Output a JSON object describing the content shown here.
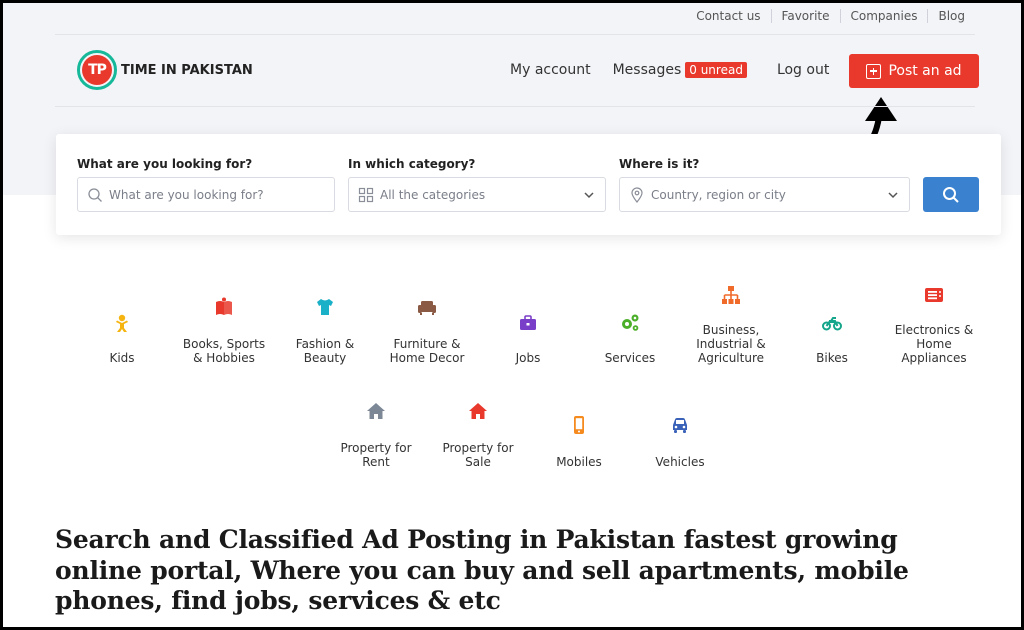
{
  "topbar": {
    "links": [
      "Contact us",
      "Favorite",
      "Companies",
      "Blog"
    ]
  },
  "logo": {
    "mark": "TP",
    "text": "TIME IN PAKISTAN"
  },
  "nav": {
    "my_account": "My account",
    "messages": "Messages",
    "unread_badge": "0 unread",
    "logout": "Log out",
    "post_ad": "Post an ad"
  },
  "search": {
    "what_label": "What are you looking for?",
    "what_placeholder": "What are you looking for?",
    "category_label": "In which category?",
    "category_value": "All the categories",
    "where_label": "Where is it?",
    "where_placeholder": "Country, region or city"
  },
  "categories": [
    {
      "label": "Kids",
      "icon": "baby-icon",
      "color": "#f5b40f"
    },
    {
      "label": "Books, Sports & Hobbies",
      "icon": "book-icon",
      "color": "#e8392c"
    },
    {
      "label": "Fashion & Beauty",
      "icon": "tshirt-icon",
      "color": "#1ab0c8"
    },
    {
      "label": "Furniture & Home Decor",
      "icon": "sofa-icon",
      "color": "#8a5a44"
    },
    {
      "label": "Jobs",
      "icon": "briefcase-icon",
      "color": "#7a3fc8"
    },
    {
      "label": "Services",
      "icon": "gears-icon",
      "color": "#4caf2a"
    },
    {
      "label": "Business, Industrial & Agriculture",
      "icon": "sitemap-icon",
      "color": "#f06a2a"
    },
    {
      "label": "Bikes",
      "icon": "motorcycle-icon",
      "color": "#15a58a"
    },
    {
      "label": "Electronics & Home Appliances",
      "icon": "appliance-icon",
      "color": "#e8392c"
    },
    {
      "label": "Property for Rent",
      "icon": "home-icon",
      "color": "#7d8896"
    },
    {
      "label": "Property for Sale",
      "icon": "home-icon",
      "color": "#e8392c"
    },
    {
      "label": "Mobiles",
      "icon": "mobile-icon",
      "color": "#f58a1f"
    },
    {
      "label": "Vehicles",
      "icon": "car-icon",
      "color": "#3a62b8"
    }
  ],
  "headline": "Search and Classified Ad Posting in Pakistan fastest growing online portal, Where you can buy and sell apartments, mobile phones, find jobs, services & etc",
  "colors": {
    "accent_red": "#e8392c",
    "search_blue": "#3a82d0",
    "logo_teal": "#16b89a"
  }
}
